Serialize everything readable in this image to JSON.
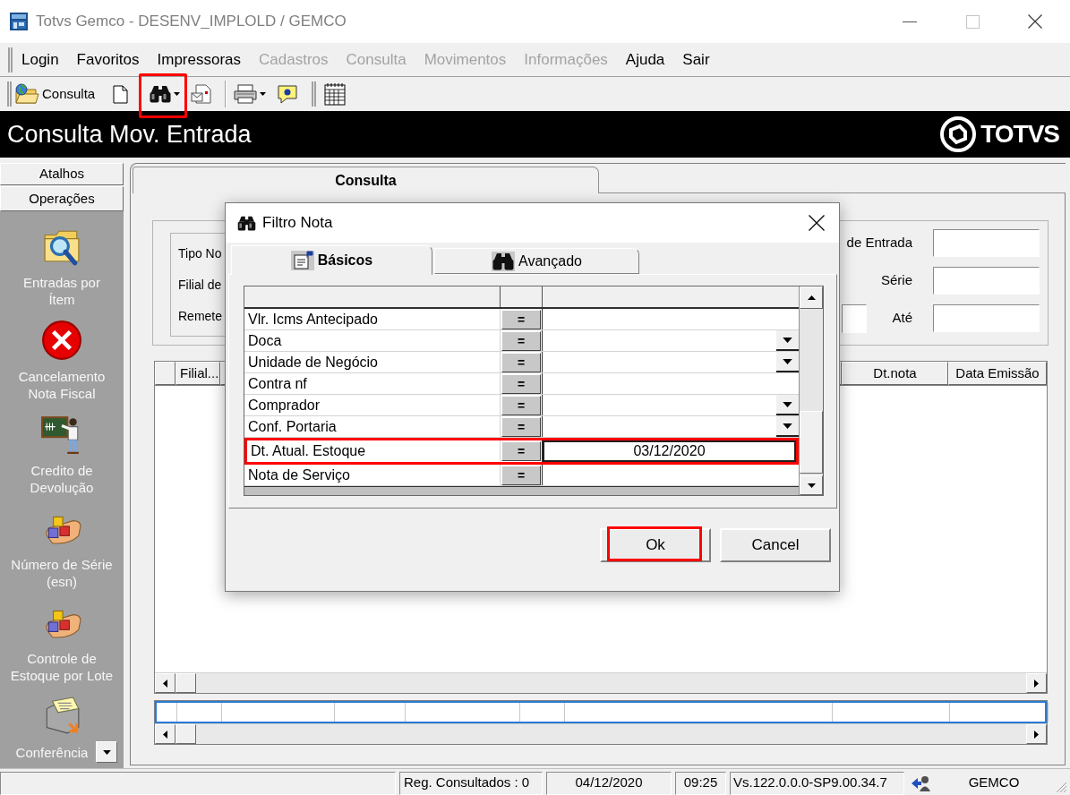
{
  "window": {
    "title": "Totvs Gemco - DESENV_IMPLOLD / GEMCO"
  },
  "menu": [
    {
      "label": "Login",
      "disabled": false
    },
    {
      "label": "Favoritos",
      "disabled": false
    },
    {
      "label": "Impressoras",
      "disabled": false
    },
    {
      "label": "Cadastros",
      "disabled": true
    },
    {
      "label": "Consulta",
      "disabled": true
    },
    {
      "label": "Movimentos",
      "disabled": true
    },
    {
      "label": "Informações",
      "disabled": true
    },
    {
      "label": "Ajuda",
      "disabled": false
    },
    {
      "label": "Sair",
      "disabled": false
    }
  ],
  "toolbar": {
    "groups": [
      [
        {
          "label": "Consulta",
          "dropdown": false,
          "highlighted": false
        },
        {
          "dropdown": false,
          "highlighted": false
        }
      ],
      [
        {
          "dropdown": true,
          "highlighted": true
        },
        {
          "dropdown": false,
          "highlighted": false
        }
      ],
      [
        {
          "dropdown": true,
          "highlighted": false
        },
        {
          "dropdown": false,
          "highlighted": false
        }
      ],
      [
        {
          "dropdown": false,
          "highlighted": false
        }
      ]
    ]
  },
  "header": {
    "title": "Consulta Mov. Entrada",
    "logo": "TOTVS"
  },
  "sidebar": {
    "sections": [
      "Atalhos",
      "Operações"
    ],
    "items": [
      "Entradas por\nÍtem",
      "Cancelamento\nNota Fiscal",
      "Credito de\nDevolução",
      "Número de Série\n(esn)",
      "Controle de\nEstoque por Lote",
      "Conferência"
    ]
  },
  "main": {
    "tabs": [
      {
        "label": "Consulta",
        "selected": true
      }
    ],
    "form": {
      "left_labels": [
        "Tipo No",
        "Filial de",
        "Remete"
      ],
      "right_fields": [
        {
          "label": "de Entrada"
        },
        {
          "label": "Série"
        },
        {
          "label": "Até"
        }
      ]
    },
    "grid": {
      "columns": [
        "Filial...",
        "Dt.nota",
        "Data Emissão"
      ]
    }
  },
  "dialog": {
    "title": "Filtro Nota",
    "tabs": [
      {
        "label": "Básicos",
        "selected": true
      },
      {
        "label": "Avançado",
        "selected": false
      }
    ],
    "rows": [
      {
        "label": "Vlr. Icms Antecipado",
        "operator": "=",
        "dropdown": false,
        "selected": false,
        "highlighted": false
      },
      {
        "label": "Doca",
        "operator": "=",
        "dropdown": true,
        "selected": false,
        "highlighted": false
      },
      {
        "label": "Unidade de Negócio",
        "operator": "=",
        "dropdown": true,
        "selected": false,
        "highlighted": false
      },
      {
        "label": "Contra nf",
        "operator": "=",
        "dropdown": false,
        "selected": false,
        "highlighted": false
      },
      {
        "label": "Comprador",
        "operator": "=",
        "dropdown": true,
        "selected": false,
        "highlighted": false
      },
      {
        "label": "Conf. Portaria",
        "operator": "=",
        "dropdown": true,
        "selected": false,
        "highlighted": false
      },
      {
        "label": "Dt. Atual. Estoque",
        "operator": "=",
        "value": "03/12/2020",
        "dropdown": false,
        "selected": true,
        "highlighted": true
      },
      {
        "label": "Nota de Serviço",
        "operator": "=",
        "dropdown": false,
        "selected": false,
        "highlighted": false
      }
    ],
    "buttons": [
      {
        "label": "Ok",
        "highlighted": true
      },
      {
        "label": "Cancel",
        "highlighted": false
      }
    ]
  },
  "status_bar": [
    "Reg. Consultados : 0",
    "04/12/2020",
    "09:25",
    "Vs.122.0.0.0-SP9.00.34.7",
    "GEMCO"
  ]
}
